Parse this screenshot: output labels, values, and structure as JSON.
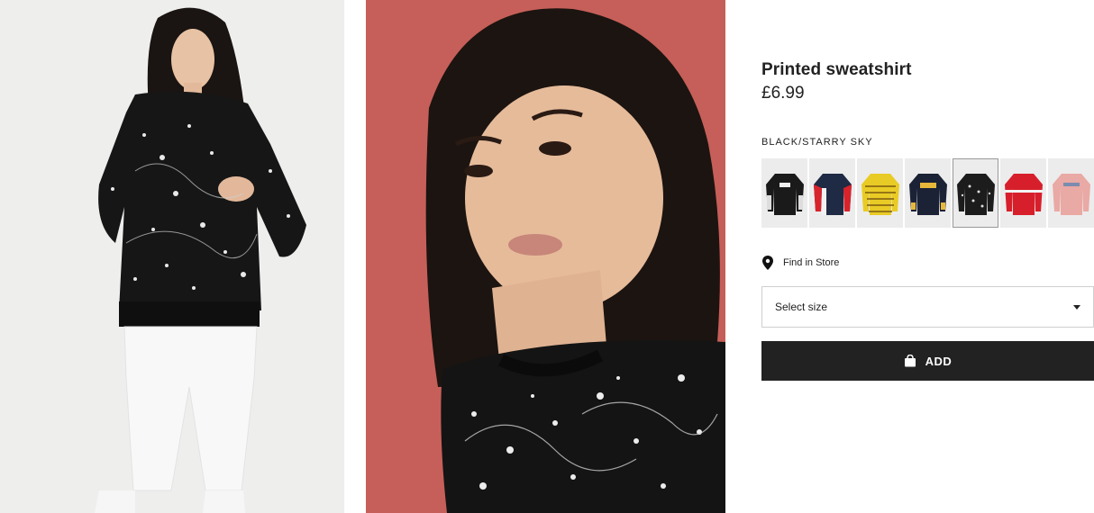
{
  "product": {
    "title": "Printed sweatshirt",
    "price": "£6.99",
    "colour_name": "BLACK/STARRY SKY"
  },
  "images": [
    {
      "description_icon": "model-full-body-photo"
    },
    {
      "description_icon": "model-closeup-photo"
    }
  ],
  "swatches": [
    {
      "icon": "black-nyc-sweatshirt",
      "color": "#1a1a1a",
      "selected": false
    },
    {
      "icon": "navy-red-colorblock-sweatshirt",
      "color": "#1f2a44",
      "selected": false
    },
    {
      "icon": "yellow-striped-sweatshirt",
      "color": "#e8c923",
      "selected": false
    },
    {
      "icon": "navy-print-sweatshirt",
      "color": "#1b2236",
      "selected": false
    },
    {
      "icon": "black-starry-sky-sweatshirt",
      "color": "#1c1c1c",
      "selected": true
    },
    {
      "icon": "red-sweatshirt",
      "color": "#d71f2b",
      "selected": false
    },
    {
      "icon": "pink-sweatshirt",
      "color": "#e9a9a4",
      "selected": false
    }
  ],
  "store": {
    "label": "Find in Store",
    "icon": "location-pin-icon"
  },
  "size_select": {
    "label": "Select size",
    "icon": "chevron-down-icon"
  },
  "add_button": {
    "label": "ADD",
    "icon": "shopping-bag-icon"
  }
}
